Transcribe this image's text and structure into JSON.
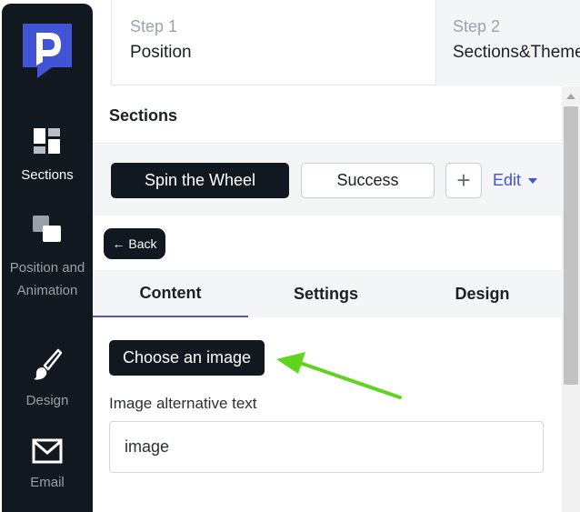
{
  "steps": [
    {
      "number": "Step 1",
      "title": "Position"
    },
    {
      "number": "Step 2",
      "title": "Sections&Theme"
    }
  ],
  "sidebar": {
    "items": [
      {
        "label": "Sections",
        "icon": "sections-icon",
        "active": true
      },
      {
        "label": "Position and Animation",
        "icon": "position-icon",
        "active": false
      },
      {
        "label": "Design",
        "icon": "brush-icon",
        "active": false
      },
      {
        "label": "Email",
        "icon": "envelope-icon",
        "active": false
      }
    ]
  },
  "sections": {
    "title": "Sections",
    "tabs": [
      "Spin the Wheel",
      "Success"
    ],
    "add_label": "+",
    "edit_label": "Edit"
  },
  "back_label": "← Back",
  "subtabs": [
    "Content",
    "Settings",
    "Design"
  ],
  "content": {
    "choose_image_label": "Choose an image",
    "alt_text_label": "Image alternative text",
    "alt_text_value": "image"
  },
  "colors": {
    "sidebar_bg": "#121820",
    "logo": "#4254d6",
    "accent": "#4254d6",
    "arrow": "#5fd41f"
  }
}
